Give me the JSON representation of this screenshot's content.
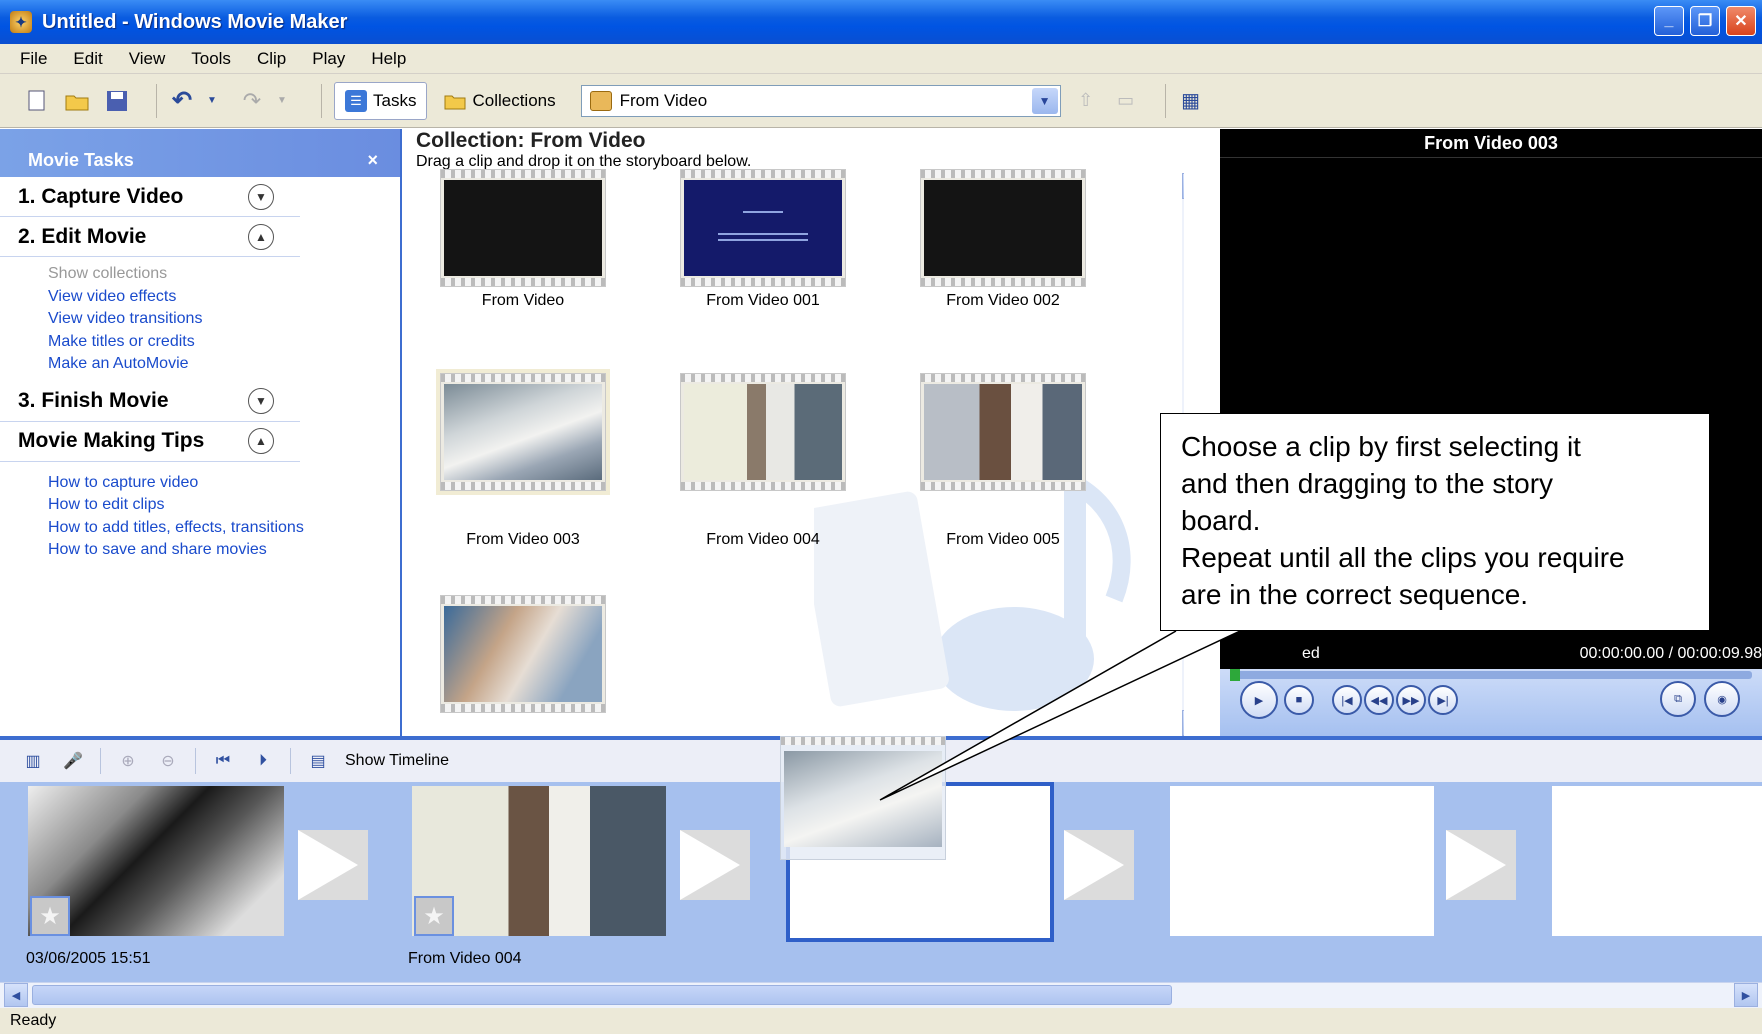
{
  "window": {
    "title": "Untitled - Windows Movie Maker"
  },
  "menu": [
    "File",
    "Edit",
    "View",
    "Tools",
    "Clip",
    "Play",
    "Help"
  ],
  "toolbar": {
    "tasks_label": "Tasks",
    "collections_label": "Collections",
    "collection_selected": "From Video"
  },
  "tasks_pane": {
    "header": "Movie Tasks",
    "close": "×",
    "sections": [
      {
        "title": "1. Capture Video",
        "links": []
      },
      {
        "title": "2. Edit Movie",
        "links": [
          "Show collections",
          "View video effects",
          "View video transitions",
          "Make titles or credits",
          "Make an AutoMovie"
        ]
      },
      {
        "title": "3. Finish Movie",
        "links": []
      },
      {
        "title": "Movie Making Tips",
        "links": [
          "How to capture video",
          "How to edit clips",
          "How to add titles, effects, transitions",
          "How to save and share movies"
        ]
      }
    ]
  },
  "collection": {
    "title": "Collection: From Video",
    "subtitle": "Drag a clip and drop it on the storyboard below.",
    "clips": [
      {
        "label": "From Video"
      },
      {
        "label": "From Video 001"
      },
      {
        "label": "From Video 002"
      },
      {
        "label": "From Video 003"
      },
      {
        "label": "From Video 004"
      },
      {
        "label": "From Video 005"
      },
      {
        "label": ""
      }
    ]
  },
  "preview": {
    "title": "From Video 003",
    "status": "ed",
    "time": "00:00:00.00 / 00:00:09.98"
  },
  "callout": {
    "lines": [
      "Choose a clip by first selecting it",
      "and then dragging to the story",
      "board.",
      "Repeat until all the clips you require",
      "are in the correct sequence."
    ]
  },
  "storyboard": {
    "show_timeline": "Show Timeline",
    "items": [
      {
        "label": "03/06/2005 15:51"
      },
      {
        "label": "From Video 004"
      }
    ]
  },
  "status": {
    "text": "Ready"
  }
}
